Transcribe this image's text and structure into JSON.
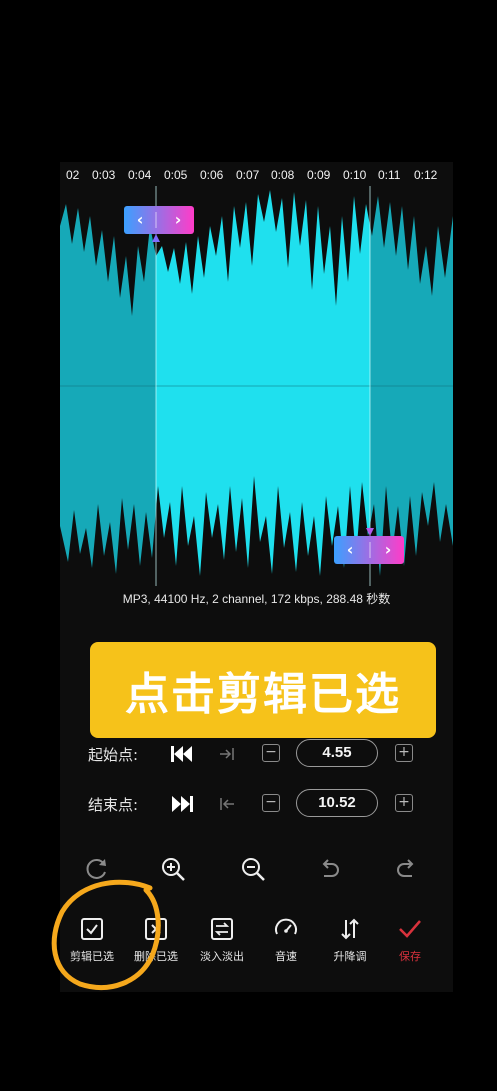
{
  "timeline": {
    "ticks": [
      "02",
      "0:03",
      "0:04",
      "0:05",
      "0:06",
      "0:07",
      "0:08",
      "0:09",
      "0:10",
      "0:11",
      "0:12"
    ]
  },
  "audio_info": "MP3, 44100 Hz, 2 channel, 172 kbps, 288.48 秒数",
  "banner_text": "点击剪辑已选",
  "trim": {
    "start": {
      "label": "起始点:",
      "value": "4.55",
      "minus": "−",
      "plus": "+"
    },
    "end": {
      "label": "结束点:",
      "value": "10.52",
      "minus": "−",
      "plus": "+"
    }
  },
  "tools": [
    "redo-icon",
    "zoom-in-icon",
    "zoom-out-icon",
    "undo-icon",
    "redo-icon"
  ],
  "bottom_bar": {
    "items": [
      {
        "label": "剪辑已选",
        "icon": "checkbox-icon"
      },
      {
        "label": "删除已选",
        "icon": "delete-box-icon"
      },
      {
        "label": "淡入淡出",
        "icon": "fade-icon"
      },
      {
        "label": "音速",
        "icon": "speedometer-icon"
      },
      {
        "label": "升降调",
        "icon": "pitch-icon"
      },
      {
        "label": "保存",
        "icon": "check-icon"
      }
    ]
  },
  "colors": {
    "waveform_unselected": "#16a9b8",
    "waveform_selected": "#1fe0ee",
    "handle_gradient_start": "#3ba0ff",
    "handle_gradient_end": "#ff3cc8",
    "banner": "#f6c21a",
    "save_red": "#d8323c",
    "annotation_circle": "#f5a81c"
  }
}
